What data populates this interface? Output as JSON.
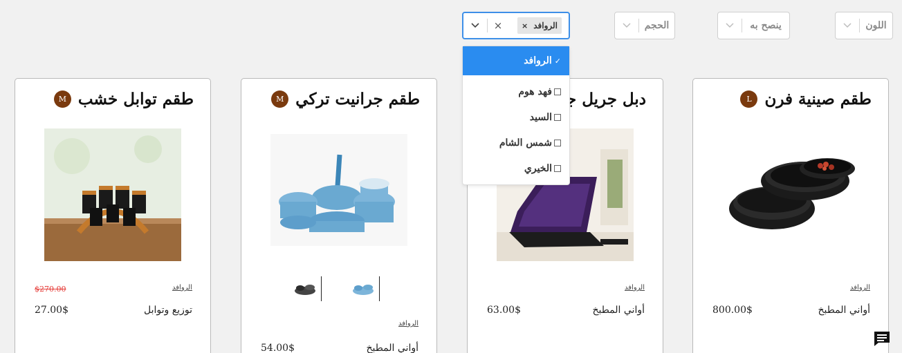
{
  "filters": {
    "color": {
      "label": "اللون"
    },
    "recommended": {
      "label": "ينصح به"
    },
    "size": {
      "label": "الحجم"
    },
    "brand": {
      "selected_chip": "الروافد",
      "chip_remove": "×",
      "clear": "×"
    }
  },
  "brand_menu": {
    "options": [
      {
        "label": "الروافد",
        "selected": true
      },
      {
        "label": "فهد هوم",
        "selected": false
      },
      {
        "label": "السيد",
        "selected": false
      },
      {
        "label": "شمس الشام",
        "selected": false
      },
      {
        "label": "الخيري",
        "selected": false
      }
    ],
    "check_mark": "✓"
  },
  "products": [
    {
      "title": "طقم صينية فرن",
      "avatar": "L",
      "brand": "الروافد",
      "category": "أواني المطبخ",
      "price": "800.00$"
    },
    {
      "title": "دبل جريل جرانيت",
      "avatar": "",
      "brand": "الروافد",
      "category": "أواني المطبخ",
      "price": "63.00$"
    },
    {
      "title": "طقم جرانيت تركي",
      "avatar": "M",
      "brand": "الروافد",
      "category": "أواني المطبخ",
      "price": "54.00$"
    },
    {
      "title": "طقم توابل خشب",
      "avatar": "M",
      "brand": "الروافد",
      "category": "توزيع وتوابل",
      "price": "27.00$",
      "old_price": "$270.00"
    }
  ],
  "colors": {
    "accent": "#2a8cf0",
    "avatar": "#7a3a0e",
    "sale": "#e53935",
    "background": "#f1f1f1"
  }
}
